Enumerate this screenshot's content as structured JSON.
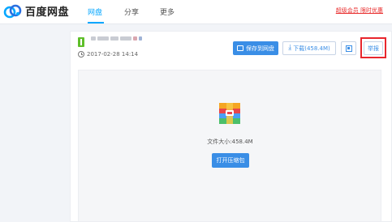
{
  "app": {
    "logo_text": "百度网盘",
    "nav": [
      "网盘",
      "分享",
      "更多"
    ],
    "promo_link": "超级会员 限时优惠"
  },
  "file": {
    "date": "2017-02-28 14:14",
    "size_label": "文件大小:458.4M"
  },
  "actions": {
    "save": "保存到网盘",
    "download": "下载(458.4M)",
    "report": "举报",
    "open_archive": "打开压缩包"
  },
  "icons": {
    "logo": "baidu-cloud-icon",
    "file": "file-icon",
    "clock": "clock-icon",
    "save": "save-to-cloud-icon",
    "download": "download-icon",
    "qr": "qr-code-icon",
    "archive": "zip-archive-icon"
  },
  "colors": {
    "accent": "#06a7ff",
    "button": "#3a8ee6",
    "promo": "#e82c2c",
    "highlight_box": "#e8262d"
  }
}
